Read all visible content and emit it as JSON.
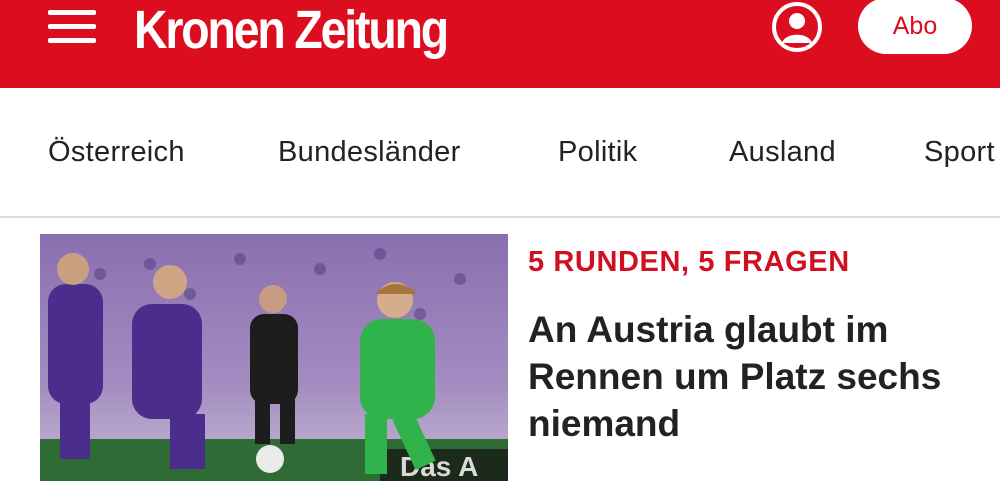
{
  "header": {
    "logo": "Kronen Zeitung",
    "menu_icon": "hamburger-menu-icon",
    "user_icon": "user-account-icon",
    "abo_label": "Abo",
    "brand_color": "#dc0d1f"
  },
  "nav": {
    "items": [
      "Österreich",
      "Bundesländer",
      "Politik",
      "Ausland",
      "Sport"
    ]
  },
  "article": {
    "kicker": "5 RUNDEN, 5 FRAGEN",
    "headline": "An Austria glaubt im Rennen um Platz sechs niemand",
    "image_text": "Das A"
  }
}
